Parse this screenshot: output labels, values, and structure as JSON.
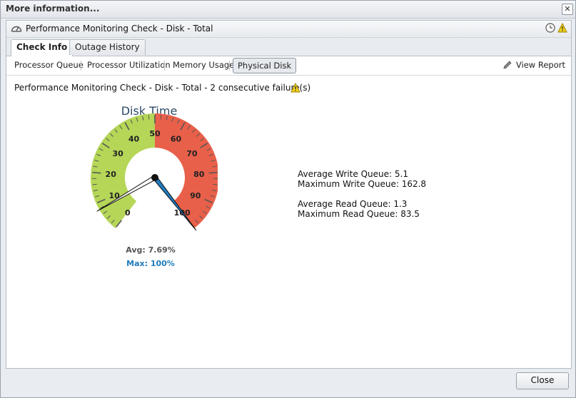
{
  "window": {
    "title": "More information..."
  },
  "panel": {
    "title": "Performance Monitoring Check - Disk - Total"
  },
  "tabs": [
    {
      "label": "Check Info",
      "active": true
    },
    {
      "label": "Outage History",
      "active": false
    }
  ],
  "subtabs": [
    {
      "label": "Processor Queue",
      "active": false
    },
    {
      "label": "Processor Utilization",
      "active": false
    },
    {
      "label": "Memory Usage",
      "active": false
    },
    {
      "label": "Physical Disk",
      "active": true
    }
  ],
  "view_report_label": "View Report",
  "status_text": "Performance Monitoring Check - Disk - Total - 2 consecutive failure(s)",
  "gauge": {
    "title": "Disk Time",
    "min": 0,
    "max": 100,
    "tick_labels": [
      "0",
      "10",
      "20",
      "30",
      "40",
      "50",
      "60",
      "70",
      "80",
      "90",
      "100"
    ],
    "bands": [
      {
        "from": 0,
        "to": 50,
        "color": "#b5d657"
      },
      {
        "from": 50,
        "to": 100,
        "color": "#e8604a"
      }
    ],
    "avg_value": 7.69,
    "max_value": 100,
    "avg_label": "Avg: 7.69%",
    "max_label": "Max: 100%",
    "max_color": "#1f7bbf"
  },
  "stats": {
    "avg_write": "Average Write Queue: 5.1",
    "max_write": "Maximum Write Queue: 162.8",
    "avg_read": "Average Read Queue: 1.3",
    "max_read": "Maximum Read Queue: 83.5"
  },
  "close_button": "Close"
}
